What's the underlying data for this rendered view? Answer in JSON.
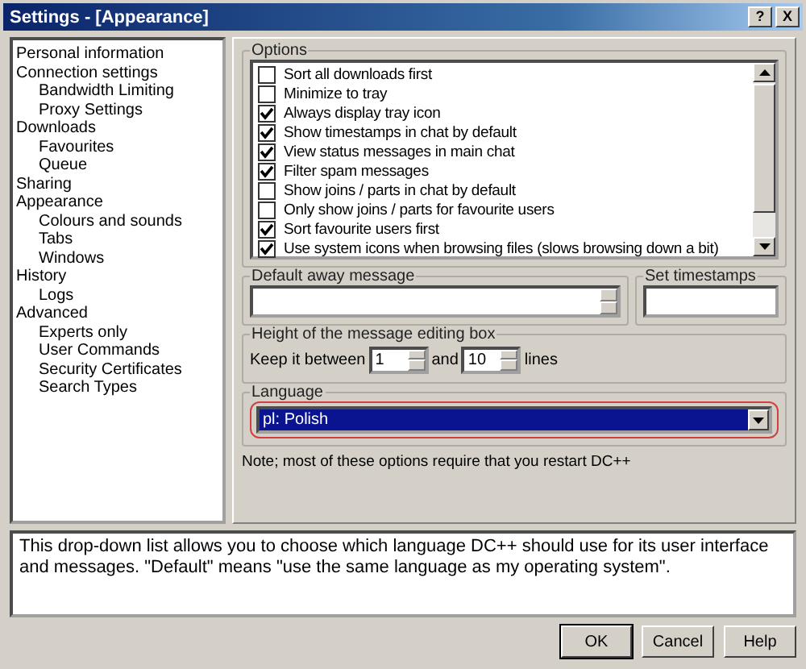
{
  "window": {
    "title": "Settings - [Appearance]",
    "help_glyph": "?",
    "close_glyph": "X"
  },
  "tree": [
    {
      "label": "Personal information"
    },
    {
      "label": "Connection settings",
      "children": [
        {
          "label": "Bandwidth Limiting"
        },
        {
          "label": "Proxy Settings"
        }
      ]
    },
    {
      "label": "Downloads",
      "children": [
        {
          "label": "Favourites"
        },
        {
          "label": "Queue"
        }
      ]
    },
    {
      "label": "Sharing"
    },
    {
      "label": "Appearance",
      "children": [
        {
          "label": "Colours and sounds"
        },
        {
          "label": "Tabs"
        },
        {
          "label": "Windows"
        }
      ]
    },
    {
      "label": "History",
      "children": [
        {
          "label": "Logs"
        }
      ]
    },
    {
      "label": "Advanced",
      "children": [
        {
          "label": "Experts only"
        },
        {
          "label": "User Commands"
        },
        {
          "label": "Security Certificates"
        },
        {
          "label": "Search Types"
        }
      ]
    }
  ],
  "options": {
    "title": "Options",
    "items": [
      {
        "label": "Sort all downloads first",
        "checked": false
      },
      {
        "label": "Minimize to tray",
        "checked": false
      },
      {
        "label": "Always display tray icon",
        "checked": true
      },
      {
        "label": "Show timestamps in chat by default",
        "checked": true
      },
      {
        "label": "View status messages in main chat",
        "checked": true
      },
      {
        "label": "Filter spam messages",
        "checked": true
      },
      {
        "label": "Show joins / parts in chat by default",
        "checked": false
      },
      {
        "label": "Only show joins / parts for favourite users",
        "checked": false
      },
      {
        "label": "Sort favourite users first",
        "checked": true
      },
      {
        "label": "Use system icons when browsing files (slows browsing down a bit)",
        "checked": true
      }
    ]
  },
  "away": {
    "title": "Default away message"
  },
  "timestamps": {
    "title": "Set timestamps"
  },
  "height_box": {
    "title": "Height of the message editing box",
    "prefix": "Keep it between",
    "min": "1",
    "middle": "and",
    "max": "10",
    "suffix": "lines"
  },
  "language": {
    "title": "Language",
    "value": "pl: Polish"
  },
  "note": "Note; most of these options require that you restart DC++",
  "description": "This drop-down list allows you to choose which language DC++ should use for its user interface and messages. \"Default\" means \"use the same language as my operating system\".",
  "buttons": [
    "OK",
    "Cancel",
    "Help"
  ]
}
